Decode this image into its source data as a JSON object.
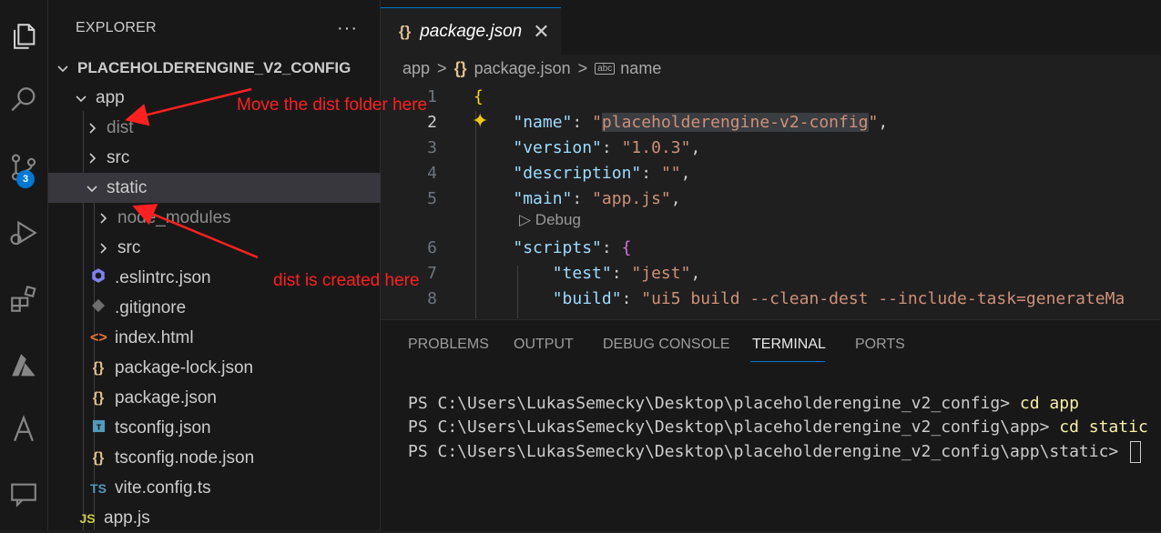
{
  "sidebar": {
    "header": "EXPLORER",
    "more": "···",
    "root": "PLACEHOLDERENGINE_V2_CONFIG",
    "items": [
      {
        "label": "app"
      },
      {
        "label": "dist"
      },
      {
        "label": "src"
      },
      {
        "label": "static"
      },
      {
        "label": "node_modules"
      },
      {
        "label": "src"
      },
      {
        "label": ".eslintrc.json"
      },
      {
        "label": ".gitignore"
      },
      {
        "label": "index.html"
      },
      {
        "label": "package-lock.json"
      },
      {
        "label": "package.json"
      },
      {
        "label": "tsconfig.json"
      },
      {
        "label": "tsconfig.node.json"
      },
      {
        "label": "vite.config.ts"
      },
      {
        "label": "app.js"
      }
    ],
    "icon_glyphs": {
      "json": "{}",
      "html": "<>",
      "ts": "TS",
      "js": "JS"
    }
  },
  "activity": {
    "scm_badge": "3"
  },
  "annotations": {
    "move": "Move the dist folder here",
    "created": "dist is created here",
    "color": "#ff2020"
  },
  "editor": {
    "tab": {
      "icon": "{}",
      "label": "package.json",
      "close": "✕"
    },
    "breadcrumb": {
      "part1": "app",
      "sep": ">",
      "part2": "package.json",
      "part3": "name",
      "abc": "abc"
    },
    "line_numbers": [
      "1",
      "2",
      "3",
      "4",
      "5",
      "6",
      "7",
      "8"
    ],
    "codelens": "Debug",
    "code": {
      "l1": "{",
      "name_key": "\"name\"",
      "name_q1": "\"",
      "name_val": "placeholderengine-v2-config",
      "name_q2": "\"",
      "version_key": "\"version\"",
      "version_val": "\"1.0.3\"",
      "description_key": "\"description\"",
      "description_val": "\"\"",
      "main_key": "\"main\"",
      "main_val": "\"app.js\"",
      "scripts_key": "\"scripts\"",
      "scripts_brace": "{",
      "test_key": "\"test\"",
      "test_val": "\"jest\"",
      "build_key": "\"build\"",
      "build_val": "\"ui5 build --clean-dest --include-task=generateMa",
      "colon": ": ",
      "comma": ","
    }
  },
  "panel": {
    "tabs": [
      "PROBLEMS",
      "OUTPUT",
      "DEBUG CONSOLE",
      "TERMINAL",
      "PORTS"
    ],
    "active_tab": "TERMINAL",
    "terminal": [
      {
        "prompt": "PS C:\\Users\\LukasSemecky\\Desktop\\placeholderengine_v2_config> ",
        "cmd": "cd app"
      },
      {
        "prompt": "PS C:\\Users\\LukasSemecky\\Desktop\\placeholderengine_v2_config\\app> ",
        "cmd": "cd static"
      },
      {
        "prompt": "PS C:\\Users\\LukasSemecky\\Desktop\\placeholderengine_v2_config\\app\\static> ",
        "cmd": ""
      }
    ]
  },
  "colors": {
    "accent": "#0078d4",
    "json_icon": "#e2c08d",
    "string": "#ce9178",
    "key": "#9cdcfe"
  }
}
